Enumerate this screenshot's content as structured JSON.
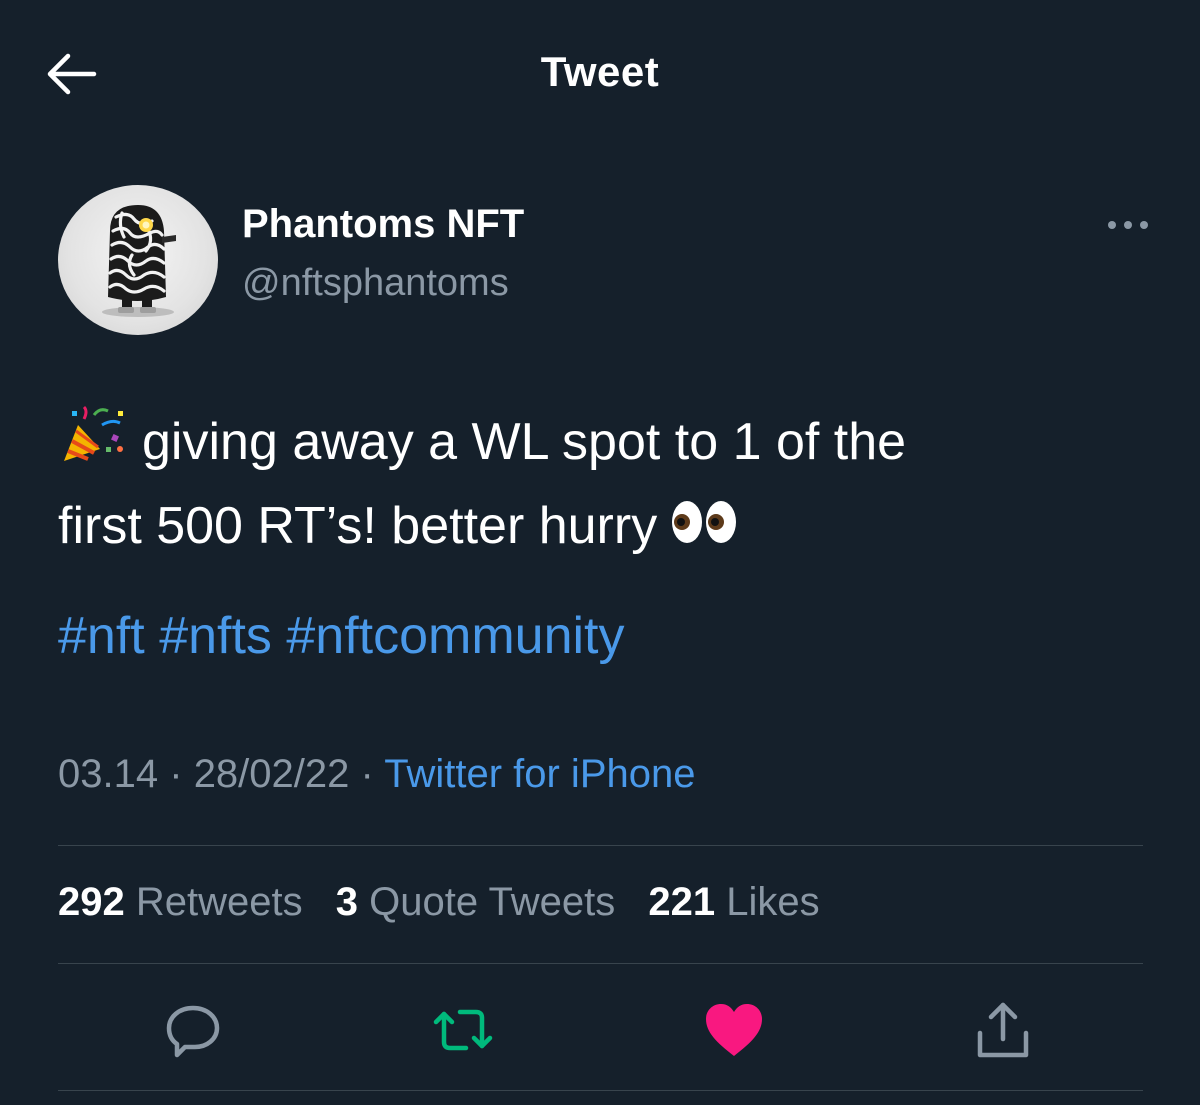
{
  "header": {
    "title": "Tweet",
    "back_icon": "arrow-left-icon"
  },
  "author": {
    "name": "Phantoms NFT",
    "handle": "@nftsphantoms",
    "avatar_icon": "avatar"
  },
  "tweet": {
    "text_line_1": "giving away a WL spot to 1 of the",
    "text_line_2": "first 500 RT’s! better hurry",
    "leading_emoji": "party-popper-icon",
    "trailing_emoji": "eyes-icon",
    "hashtags": [
      "#nft",
      "#nfts",
      "#nftcommunity"
    ]
  },
  "meta": {
    "time": "03.14",
    "separator": "·",
    "date": "28/02/22",
    "source": "Twitter for iPhone"
  },
  "stats": {
    "retweets_count": "292",
    "retweets_label": "Retweets",
    "quotes_count": "3",
    "quotes_label": "Quote Tweets",
    "likes_count": "221",
    "likes_label": "Likes"
  },
  "actions": {
    "reply_icon": "reply-icon",
    "retweet_icon": "retweet-icon",
    "like_icon": "heart-icon",
    "share_icon": "share-icon"
  },
  "colors": {
    "background": "#15202b",
    "link": "#4a99e9",
    "muted": "#8b98a5",
    "retweet_green": "#00ba7c",
    "like_pink": "#f91880",
    "divider": "#38444d"
  }
}
